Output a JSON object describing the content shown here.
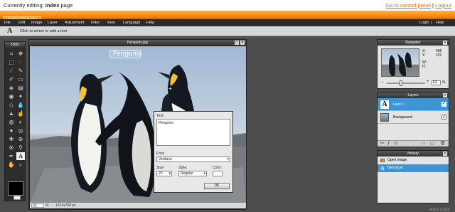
{
  "topbar": {
    "prefix": "Currently editing:",
    "page": "index",
    "suffix": "page",
    "control_panel": "Go to control panel",
    "separator": "|",
    "logout": "Logout"
  },
  "orangebar": {
    "title": "Untitled Navigator"
  },
  "menu": [
    "File",
    "Edit",
    "Image",
    "Layer",
    "Adjustment",
    "Filter",
    "View",
    "Language",
    "Help"
  ],
  "menu_right": {
    "login": "Login",
    "separator": "|",
    "help": "Help"
  },
  "optbar": {
    "hint": "Click to select or add a text"
  },
  "tools": {
    "title": "Tools"
  },
  "canvas": {
    "title": "Penguins.jpg",
    "text_overlay": "Penguins",
    "zoom": "62",
    "zoom_unit": "%",
    "size": "1024x768 px"
  },
  "text_dialog": {
    "text_label": "Text:",
    "text_value": "Penguins",
    "font_label": "Font:",
    "font_value": "Verdana",
    "size_label": "Size:",
    "size_value": "20",
    "style_label": "Style:",
    "style_value": "Regular",
    "color_label": "Color:",
    "ok": "OK",
    "color": "#ffffff"
  },
  "navigator": {
    "title": "Navigator",
    "x_label": "X:",
    "x_value": "456",
    "y_label": "Y:",
    "y_value": "151",
    "w_label": "W:",
    "w_value": "",
    "h_label": "H:",
    "h_value": "",
    "zoom": "62",
    "zoom_unit": "%"
  },
  "layers": {
    "title": "Layers",
    "items": [
      {
        "name": "Layer 1",
        "selected": true
      },
      {
        "name": "Background",
        "selected": false
      }
    ]
  },
  "history": {
    "title": "History",
    "items": [
      {
        "name": "Open image",
        "selected": false
      },
      {
        "name": "New layer",
        "selected": true
      }
    ]
  },
  "footer": {
    "credit": "PIXLR 3.3.0.0"
  },
  "colors": {
    "accent": "#f07800",
    "selection": "#3d95d6",
    "panel_dark": "#2d2d2d"
  }
}
